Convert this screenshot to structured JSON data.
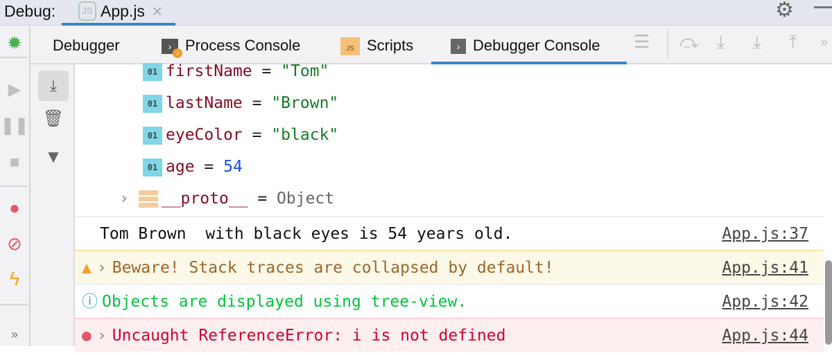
{
  "header": {
    "label": "Debug:",
    "file_tab": "App.js"
  },
  "tabs": [
    {
      "label": "Debugger"
    },
    {
      "label": "Process Console"
    },
    {
      "label": "Scripts"
    },
    {
      "label": "Debugger Console",
      "active": true
    }
  ],
  "tree": [
    {
      "key": "firstName",
      "eq": " = ",
      "value": "\"Tom\"",
      "type": "str"
    },
    {
      "key": "lastName",
      "eq": " = ",
      "value": "\"Brown\"",
      "type": "str"
    },
    {
      "key": "eyeColor",
      "eq": " = ",
      "value": "\"black\"",
      "type": "str"
    },
    {
      "key": "age",
      "eq": " = ",
      "value": "54",
      "type": "num"
    },
    {
      "key": "__proto__",
      "eq": " = ",
      "value": "Object",
      "type": "obj"
    }
  ],
  "logs": [
    {
      "text": "Tom Brown  with black eyes is 54 years old.",
      "source": "App.js:37",
      "level": "log"
    },
    {
      "text": "Beware! Stack traces are collapsed by default!",
      "source": "App.js:41",
      "level": "warn"
    },
    {
      "text": "Objects are displayed using tree-view.",
      "source": "App.js:42",
      "level": "info"
    },
    {
      "text": "Uncaught ReferenceError: i is not defined",
      "source": "App.js:44",
      "level": "error"
    }
  ],
  "colors": {
    "accent": "#3a85c6",
    "warn_bg": "#fdf9e9",
    "error_bg": "#fdeef0",
    "info_text": "#00c43b",
    "warn_text": "#a0652a",
    "error_text": "#d0022e"
  }
}
